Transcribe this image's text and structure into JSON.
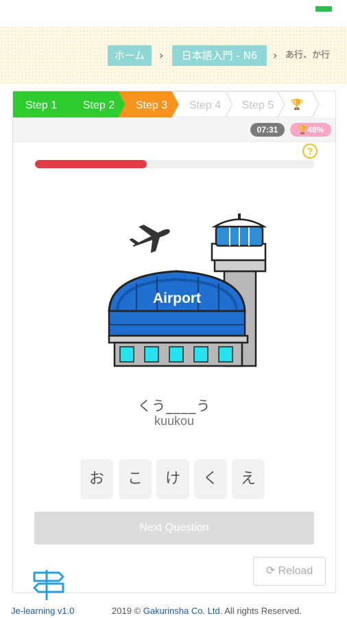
{
  "breadcrumb": {
    "home_label": "ホーム",
    "course_label": "日本語入門 - N6",
    "separator": "›",
    "current": "あ行、か行"
  },
  "steps": [
    {
      "label": "Step 1",
      "state": "done"
    },
    {
      "label": "Step 2",
      "state": "done"
    },
    {
      "label": "Step 3",
      "state": "current"
    },
    {
      "label": "Step 4",
      "state": "locked"
    },
    {
      "label": "Step 5",
      "state": "locked"
    },
    {
      "label": "",
      "icon": "trophy-icon",
      "state": "locked"
    }
  ],
  "colors": {
    "done": "#2ecc2e",
    "current": "#f7941d",
    "locked": "#ffffff",
    "progress": "#e23a46",
    "accent_teal": "#8ed7d4"
  },
  "timer": "07:31",
  "score": "48%",
  "help": "?",
  "progress": {
    "fraction": 0.4
  },
  "illustration": {
    "sign_text": "Airport"
  },
  "question": {
    "prompt": "くう____う",
    "romaji": "kuukou"
  },
  "choices": [
    "お",
    "こ",
    "け",
    "く",
    "え"
  ],
  "next_button": "Next Question",
  "reload_button": "Reload",
  "footer": {
    "brand": "Je-learning v1.0",
    "copyright_prefix": "2019 © ",
    "org": "Gakurinsha Co. Ltd",
    "copyright_suffix": ". All rights Reserved."
  }
}
